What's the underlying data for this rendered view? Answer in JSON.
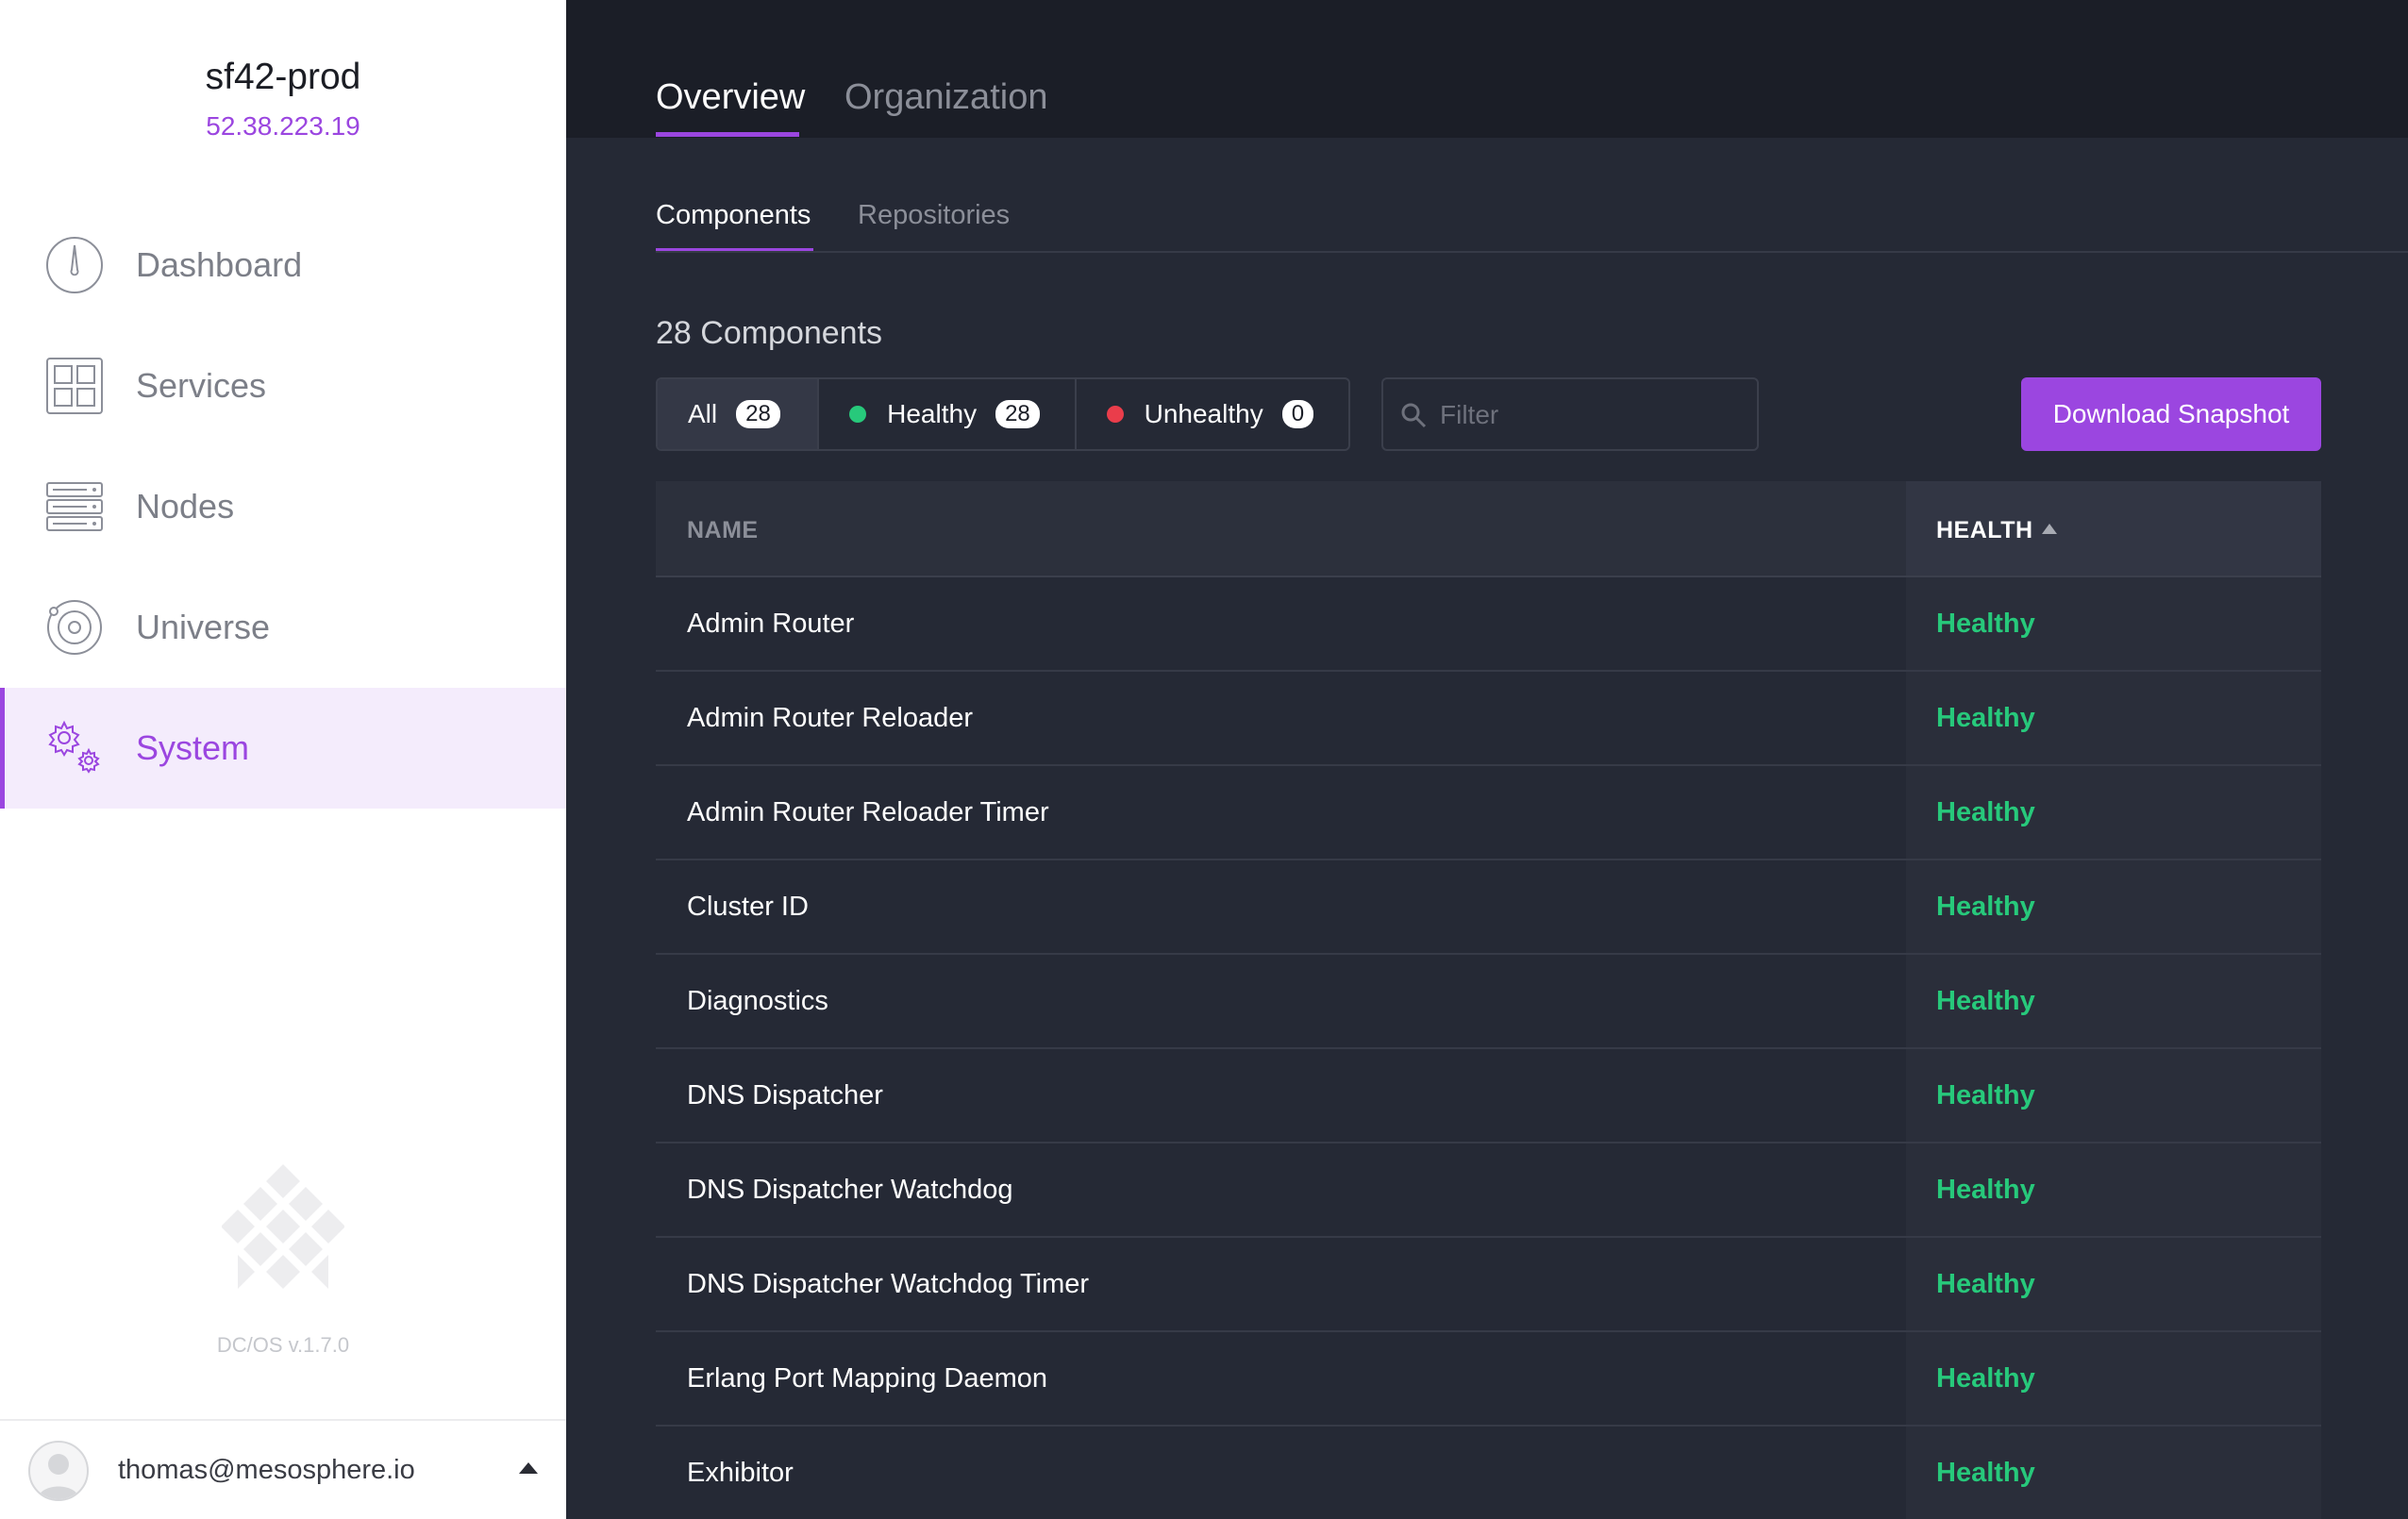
{
  "cluster": {
    "name": "sf42-prod",
    "ip": "52.38.223.19"
  },
  "sidebar": {
    "items": [
      {
        "label": "Dashboard",
        "icon": "dashboard-icon"
      },
      {
        "label": "Services",
        "icon": "services-icon"
      },
      {
        "label": "Nodes",
        "icon": "nodes-icon"
      },
      {
        "label": "Universe",
        "icon": "universe-icon"
      },
      {
        "label": "System",
        "icon": "system-icon",
        "active": true
      }
    ],
    "version": "DC/OS v.1.7.0",
    "user_email": "thomas@mesosphere.io"
  },
  "tabs": [
    {
      "label": "Overview",
      "active": true
    },
    {
      "label": "Organization",
      "active": false
    }
  ],
  "subtabs": [
    {
      "label": "Components",
      "active": true
    },
    {
      "label": "Repositories",
      "active": false
    }
  ],
  "count_heading": "28 Components",
  "filters": {
    "all": {
      "label": "All",
      "count": "28"
    },
    "healthy": {
      "label": "Healthy",
      "count": "28",
      "color": "#27c97b"
    },
    "unhealthy": {
      "label": "Unhealthy",
      "count": "0",
      "color": "#ea3d4b"
    }
  },
  "search": {
    "placeholder": "Filter",
    "value": ""
  },
  "download_button": "Download Snapshot",
  "table": {
    "columns": {
      "name": "NAME",
      "health": "HEALTH"
    },
    "rows": [
      {
        "name": "Admin Router",
        "health": "Healthy"
      },
      {
        "name": "Admin Router Reloader",
        "health": "Healthy"
      },
      {
        "name": "Admin Router Reloader Timer",
        "health": "Healthy"
      },
      {
        "name": "Cluster ID",
        "health": "Healthy"
      },
      {
        "name": "Diagnostics",
        "health": "Healthy"
      },
      {
        "name": "DNS Dispatcher",
        "health": "Healthy"
      },
      {
        "name": "DNS Dispatcher Watchdog",
        "health": "Healthy"
      },
      {
        "name": "DNS Dispatcher Watchdog Timer",
        "health": "Healthy"
      },
      {
        "name": "Erlang Port Mapping Daemon",
        "health": "Healthy"
      },
      {
        "name": "Exhibitor",
        "health": "Healthy"
      }
    ]
  },
  "colors": {
    "accent": "#9b46e0",
    "healthy": "#27c97b",
    "unhealthy": "#ea3d4b"
  }
}
